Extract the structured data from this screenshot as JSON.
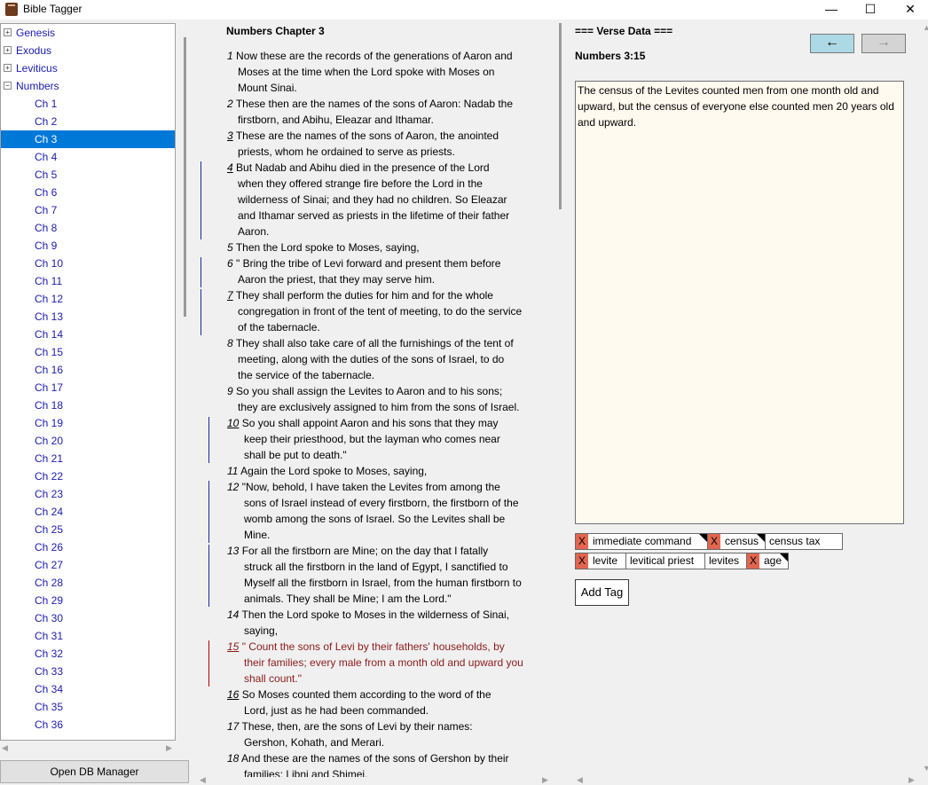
{
  "window": {
    "title": "Bible Tagger",
    "minimize": "—",
    "maximize": "☐",
    "close": "✕"
  },
  "tree": {
    "books": [
      {
        "label": "Genesis",
        "expander": "+"
      },
      {
        "label": "Exodus",
        "expander": "+"
      },
      {
        "label": "Leviticus",
        "expander": "+"
      },
      {
        "label": "Numbers",
        "expander": "−"
      }
    ],
    "chapters": [
      "Ch 1",
      "Ch 2",
      "Ch 3",
      "Ch 4",
      "Ch 5",
      "Ch 6",
      "Ch 7",
      "Ch 8",
      "Ch 9",
      "Ch 10",
      "Ch 11",
      "Ch 12",
      "Ch 13",
      "Ch 14",
      "Ch 15",
      "Ch 16",
      "Ch 17",
      "Ch 18",
      "Ch 19",
      "Ch 20",
      "Ch 21",
      "Ch 22",
      "Ch 23",
      "Ch 24",
      "Ch 25",
      "Ch 26",
      "Ch 27",
      "Ch 28",
      "Ch 29",
      "Ch 30",
      "Ch 31",
      "Ch 32",
      "Ch 33",
      "Ch 34",
      "Ch 35",
      "Ch 36"
    ],
    "selected_chapter": "Ch 3"
  },
  "db_button": "Open DB Manager",
  "chapter": {
    "title": "Numbers Chapter 3",
    "verses": [
      {
        "num": "1",
        "underline": false,
        "lines": [
          "Now these are the records of the generations of Aaron and",
          "Moses at the time when the Lord spoke with Moses on",
          "Mount Sinai."
        ]
      },
      {
        "num": "2",
        "underline": false,
        "lines": [
          "These then are the names of the sons of Aaron: Nadab the",
          "firstborn, and Abihu, Eleazar and Ithamar."
        ]
      },
      {
        "num": "3",
        "underline": true,
        "lines": [
          "These are the names of the sons of Aaron, the anointed",
          "priests, whom he ordained to serve as priests."
        ]
      },
      {
        "num": "4",
        "underline": true,
        "lines": [
          "But Nadab and Abihu died in the presence of the Lord",
          "when they offered strange fire before the Lord in the",
          "wilderness of Sinai; and they had no children. So Eleazar",
          "and Ithamar served as priests in the lifetime of their father",
          "Aaron."
        ]
      },
      {
        "num": "5",
        "underline": false,
        "lines": [
          "Then the Lord spoke to Moses, saying,"
        ]
      },
      {
        "num": "6",
        "underline": false,
        "lines": [
          "\" Bring the tribe of Levi forward and present them before",
          "Aaron the priest, that they may serve him."
        ]
      },
      {
        "num": "7",
        "underline": true,
        "lines": [
          "They shall perform the duties for him and for the whole",
          "congregation in front of the tent of meeting, to do the service",
          "of the tabernacle."
        ]
      },
      {
        "num": "8",
        "underline": false,
        "lines": [
          "They shall also take care of all the furnishings of the tent of",
          "meeting, along with the duties of the sons of Israel, to do",
          "the service of the tabernacle."
        ]
      },
      {
        "num": "9",
        "underline": false,
        "lines": [
          "So you shall assign the Levites to Aaron and to his sons;",
          "they are exclusively assigned to him from the sons of Israel."
        ]
      },
      {
        "num": "10",
        "underline": true,
        "lines": [
          "So you shall appoint Aaron and his sons that they may",
          "keep their priesthood, but the layman who comes near",
          "shall be put to death.\""
        ]
      },
      {
        "num": "11",
        "underline": false,
        "lines": [
          "Again the Lord spoke to Moses, saying,"
        ]
      },
      {
        "num": "12",
        "underline": false,
        "lines": [
          "\"Now, behold, I have taken the Levites from among the",
          "sons of Israel instead of every firstborn, the firstborn of the",
          "womb among the sons of Israel. So the Levites shall be",
          "Mine."
        ]
      },
      {
        "num": "13",
        "underline": false,
        "lines": [
          "For all the firstborn are Mine; on the day that I fatally",
          "struck all the firstborn in the land of Egypt, I sanctified to",
          "Myself all the firstborn in Israel, from the human firstborn to",
          "animals. They shall be Mine; I am the Lord.\""
        ]
      },
      {
        "num": "14",
        "underline": false,
        "lines": [
          "Then the Lord spoke to Moses in the wilderness of Sinai,",
          "saying,"
        ]
      },
      {
        "num": "15",
        "underline": true,
        "lines": [
          "\" Count the sons of Levi by their fathers' households, by",
          "their families; every male from a month old and upward you",
          "shall count.\""
        ]
      },
      {
        "num": "16",
        "underline": true,
        "lines": [
          "So Moses counted them according to the word of the",
          "Lord, just as he had been commanded."
        ]
      },
      {
        "num": "17",
        "underline": false,
        "lines": [
          "These, then, are the sons of Levi by their names:",
          "Gershon, Kohath, and Merari."
        ]
      },
      {
        "num": "18",
        "underline": false,
        "lines": [
          "And these are the names of the sons of Gershon by their",
          "families: Libni and Shimei."
        ]
      }
    ],
    "selected_verse": "15"
  },
  "verse_data": {
    "header": "=== Verse Data ===",
    "reference": "Numbers 3:15",
    "prev": "←",
    "next": "→",
    "text": " The census of the Levites counted men from one month old and upward, but the census of everyone else counted men 20 years old and upward.",
    "remove_label": "X",
    "tags": [
      {
        "label": "immediate command",
        "removable": true,
        "corner": true
      },
      {
        "label": "census",
        "removable": true,
        "corner": true
      },
      {
        "label": "census tax",
        "removable": false,
        "corner": false
      },
      {
        "label": "levite",
        "removable": true,
        "corner": false
      },
      {
        "label": "levitical priest",
        "removable": false,
        "corner": false
      },
      {
        "label": "levites",
        "removable": false,
        "corner": false
      },
      {
        "label": "age",
        "removable": true,
        "corner": true
      }
    ],
    "add_tag": "Add Tag"
  },
  "colors": {
    "selection": "#0078d7",
    "link": "#1a1ab0",
    "selected_verse": "#8b1a1a",
    "verse_box_bg": "#fffaef",
    "prev_button": "#add8e6",
    "remove_tag": "#e2664f"
  }
}
